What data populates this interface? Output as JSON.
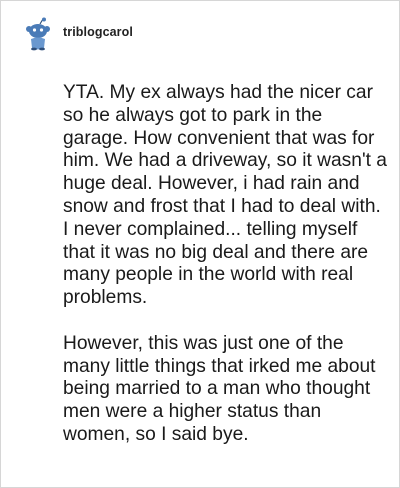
{
  "post": {
    "username": "triblogcarol",
    "avatar_icon": "reddit-snoo-avatar-icon",
    "paragraphs": [
      "YTA. My ex always had the nicer car so he always got to park in the garage. How convenient that was for him. We had a driveway, so it wasn't a huge deal. However, i had rain and snow and frost that I had to deal with. I never complained... telling myself that it was no big deal and there are many people in the world with real problems.",
      "However, this was just one of the many little things that irked me about being married to a man who thought men were a higher status than women, so I said bye."
    ]
  },
  "colors": {
    "border": "#d6d6d6",
    "text": "#1a1a1a",
    "avatar_blue": "#4a7bb7"
  }
}
